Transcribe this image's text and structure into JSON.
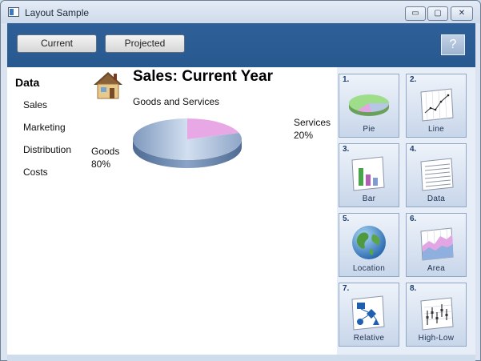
{
  "window": {
    "title": "Layout Sample",
    "controls": {
      "minimize": "▭",
      "maximize": "▢",
      "close": "✕"
    }
  },
  "toolbar": {
    "current_label": "Current",
    "projected_label": "Projected",
    "help_label": "?"
  },
  "nav": {
    "heading": "Data",
    "items": [
      "Sales",
      "Marketing",
      "Distribution",
      "Costs"
    ]
  },
  "main": {
    "title": "Sales:  Current Year",
    "subtitle": "Goods and Services",
    "goods_label": "Goods",
    "goods_pct": "80%",
    "services_label": "Services",
    "services_pct": "20%"
  },
  "chart_data": {
    "type": "pie",
    "title": "Sales:  Current Year",
    "subtitle": "Goods and Services",
    "slices": [
      {
        "label": "Goods",
        "value": 80,
        "color": "#9fb7d8"
      },
      {
        "label": "Services",
        "value": 20,
        "color": "#e8a8e6"
      }
    ]
  },
  "tiles": [
    {
      "num": "1.",
      "label": "Pie",
      "icon": "pie-chart-icon"
    },
    {
      "num": "2.",
      "label": "Line",
      "icon": "line-chart-icon"
    },
    {
      "num": "3.",
      "label": "Bar",
      "icon": "bar-chart-icon"
    },
    {
      "num": "4.",
      "label": "Data",
      "icon": "data-sheet-icon"
    },
    {
      "num": "5.",
      "label": "Location",
      "icon": "globe-icon"
    },
    {
      "num": "6.",
      "label": "Area",
      "icon": "area-chart-icon"
    },
    {
      "num": "7.",
      "label": "Relative",
      "icon": "flowchart-icon"
    },
    {
      "num": "8.",
      "label": "High-Low",
      "icon": "high-low-chart-icon"
    }
  ],
  "colors": {
    "toolbar_blue": "#2b5c95",
    "pie_main": "#9fb7d8",
    "pie_slice": "#e8a8e6"
  }
}
